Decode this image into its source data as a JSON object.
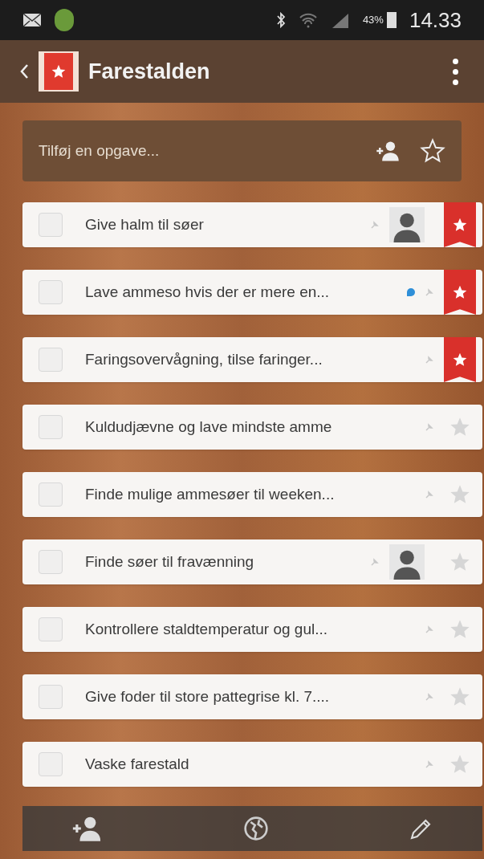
{
  "status_bar": {
    "battery_percent": "43%",
    "time": "14.33"
  },
  "header": {
    "title": "Farestalden"
  },
  "add_task": {
    "placeholder": "Tilføj en opgave..."
  },
  "tasks": [
    {
      "text": "Give halm til søer",
      "checked": false,
      "starred": true,
      "assigned": true,
      "comment": false
    },
    {
      "text": "Lave ammeso hvis der er mere en...",
      "checked": false,
      "starred": true,
      "assigned": false,
      "comment": true
    },
    {
      "text": "Faringsovervågning, tilse faringer...",
      "checked": false,
      "starred": true,
      "assigned": false,
      "comment": false
    },
    {
      "text": "Kuldudjævne og lave mindste amme",
      "checked": false,
      "starred": false,
      "assigned": false,
      "comment": false
    },
    {
      "text": "Finde mulige ammesøer til weeken...",
      "checked": false,
      "starred": false,
      "assigned": false,
      "comment": false
    },
    {
      "text": "Finde søer til fravænning",
      "checked": false,
      "starred": false,
      "assigned": true,
      "comment": false
    },
    {
      "text": "Kontrollere staldtemperatur og gul...",
      "checked": false,
      "starred": false,
      "assigned": false,
      "comment": false
    },
    {
      "text": "Give foder til store pattegrise kl. 7....",
      "checked": false,
      "starred": false,
      "assigned": false,
      "comment": false
    },
    {
      "text": "Vaske farestald",
      "checked": false,
      "starred": false,
      "assigned": false,
      "comment": false
    }
  ]
}
